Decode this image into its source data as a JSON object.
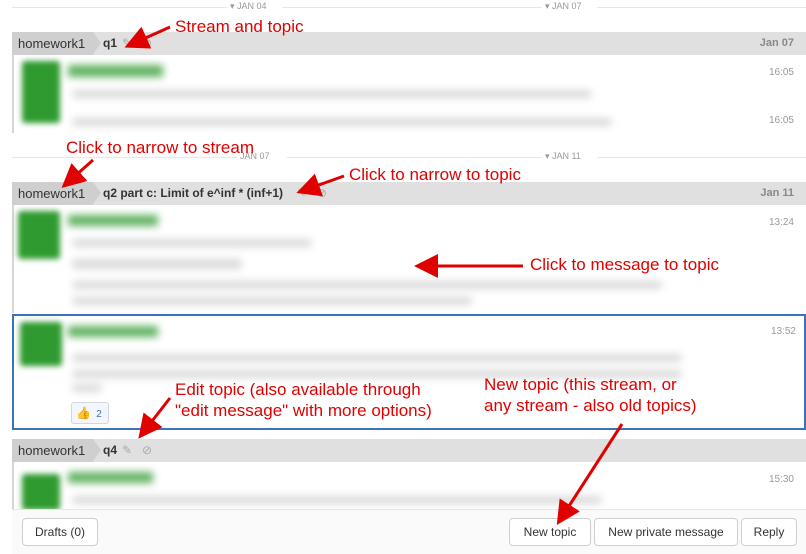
{
  "dividers": {
    "top_left": "JAN 04",
    "top_right": "JAN 07",
    "mid_left": "JAN 07",
    "mid_right": "JAN 11"
  },
  "groups": [
    {
      "stream": "homework1",
      "topic": "q1",
      "date": "Jan 07",
      "timestamps": [
        "16:05",
        "16:05"
      ]
    },
    {
      "stream": "homework1",
      "topic": "q2 part c: Limit of e^inf * (inf+1)",
      "date": "Jan 11",
      "timestamps": [
        "13:24",
        "13:52"
      ],
      "reaction": {
        "emoji": "👍",
        "count": "2"
      }
    },
    {
      "stream": "homework1",
      "topic": "q4",
      "date": "",
      "timestamps": [
        "15:30"
      ]
    }
  ],
  "annotations": {
    "stream_topic": "Stream and topic",
    "narrow_stream": "Click to narrow to stream",
    "narrow_topic": "Click to narrow to topic",
    "message_topic": "Click to message to topic",
    "edit_topic_line1": "Edit topic (also available through",
    "edit_topic_line2": "\"edit message\" with more options)",
    "new_topic_line1": "New topic (this stream, or",
    "new_topic_line2": "any stream - also old topics)"
  },
  "compose": {
    "drafts": "Drafts (0)",
    "new_topic": "New topic",
    "new_private": "New private message",
    "reply": "Reply"
  },
  "icons": {
    "edit": "pencil-icon",
    "mute": "mute-icon",
    "divider": "caret-down-icon"
  },
  "colors": {
    "annotation": "#e00000",
    "avatar": "#2f9a2f",
    "selected_border": "#3b73b9",
    "recipient_bar": "#e0e0e0"
  }
}
